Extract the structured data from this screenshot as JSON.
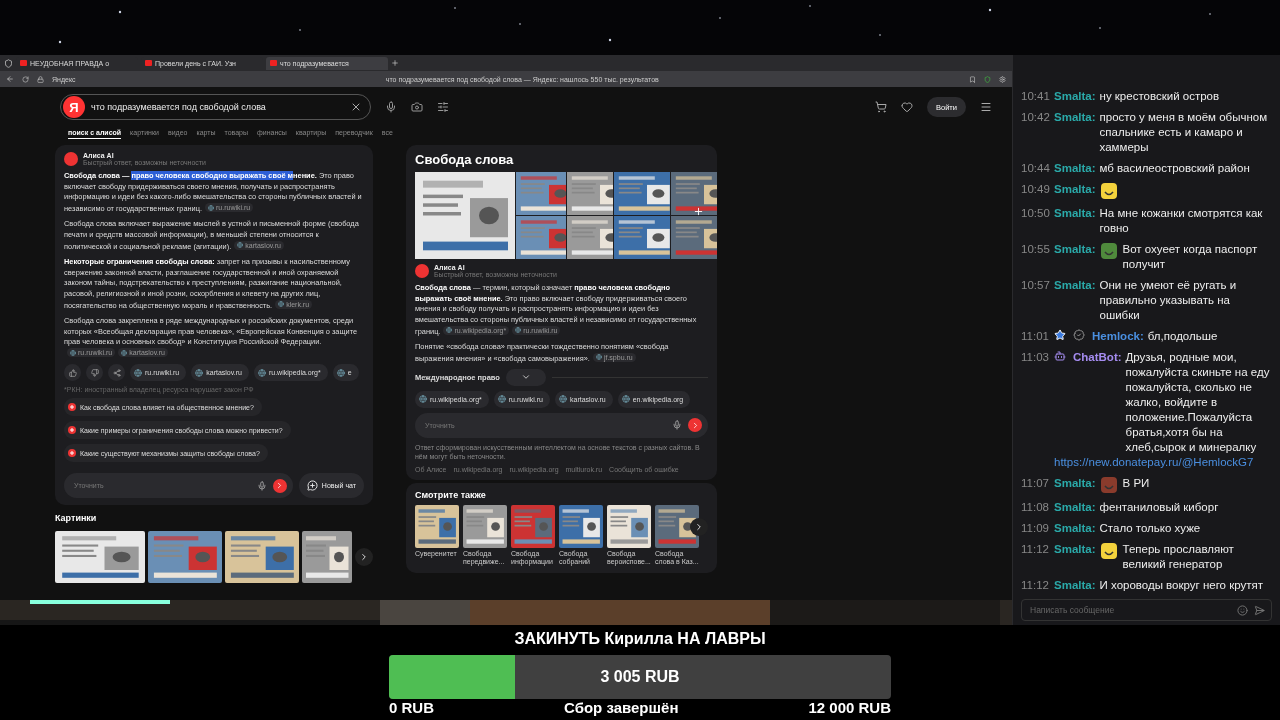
{
  "browser": {
    "tabs": [
      {
        "title": "НЕУДОБНАЯ ПРАВДА о",
        "selected": false
      },
      {
        "title": "Провели день с ГАИ. Узн",
        "selected": false
      },
      {
        "title": "что подразумевается",
        "selected": true
      }
    ],
    "address": {
      "site": "Яндекс",
      "title": "что подразумевается под свободой слова — Яндекс: нашлось 550 тыс. результатов"
    },
    "header": {
      "logo": "Я",
      "query": "что подразумевается под свободой слова",
      "login": "Войти",
      "nav": [
        {
          "label": "поиск с алисой",
          "selected": true
        },
        {
          "label": "картинки",
          "selected": false
        },
        {
          "label": "видео",
          "selected": false
        },
        {
          "label": "карты",
          "selected": false
        },
        {
          "label": "товары",
          "selected": false
        },
        {
          "label": "финансы",
          "selected": false
        },
        {
          "label": "квартиры",
          "selected": false
        },
        {
          "label": "переводчик",
          "selected": false
        },
        {
          "label": "все",
          "selected": false
        }
      ]
    },
    "ai_answer": {
      "name": "Алиса AI",
      "note": "Быстрый ответ, возможны неточности",
      "paragraphs": [
        {
          "text": "**Свобода слова —** ",
          "selection": "**право человека свободно выражать своё м**",
          "rest": "**нение.** Это право включает свободу придерживаться своего мнения, получать и распространять информацию и идеи без какого-либо вмешательства со стороны публичных властей и независимо от государственных границ.",
          "sources": [
            "ru.ruwiki.ru"
          ]
        },
        {
          "text": "Свобода слова включает выражение мыслей в устной и письменной форме (свобода печати и средств массовой информации), в меньшей степени относится к политической и социальной рекламе (агитации).",
          "sources": [
            "kartaslov.ru"
          ]
        },
        {
          "text": "**Некоторые ограничения свободы слова:** запрет на призывы к насильственному свержению законной власти, разглашение государственной и иной охраняемой законом тайны, подстрекательство к преступлениям, разжигание национальной, расовой, религиозной и иной розни, оскорбления и клевету на других лиц, посягательство на общественную мораль и нравственность.",
          "sources": [
            "klerk.ru"
          ]
        },
        {
          "text": "Свобода слова закреплена в ряде международных и российских документов, среди которых «Всеобщая декларация прав человека», «Европейская Конвенция о защите прав человека и основных свобод» и Конституция Российской Федерации.",
          "sources": [
            "ru.ruwiki.ru",
            "kartaslov.ru"
          ]
        }
      ],
      "source_chips": [
        "ru.ruwiki.ru",
        "kartaslov.ru",
        "ru.wikipedia.org*",
        "e"
      ],
      "footnote": "*РКН: иностранный владелец ресурса нарушает закон РФ",
      "suggestions": [
        "Как свобода слова влияет на общественное мнение?",
        "Какие примеры ограничения свободы слова можно привести?",
        "Какие существуют механизмы защиты свободы слова?"
      ],
      "refine_placeholder": "Уточнить",
      "new_chat": "Новый чат"
    },
    "images": {
      "title": "Картинки"
    },
    "knowledge_panel": {
      "title": "Свобода слова",
      "name": "Алиса AI",
      "note": "Быстрый ответ, возможны неточности",
      "paragraphs": [
        {
          "text": "**Свобода слова** — термин, который означает **право человека свободно выражать своё мнение.** Это право включает свободу придерживаться своего мнения и свободу получать и распространять информацию и идеи без вмешательства со стороны публичных властей и независимо от государственных границ.",
          "sources": [
            "ru.wikipedia.org*",
            "ru.ruwiki.ru"
          ]
        },
        {
          "text": "Понятие «свобода слова» практически тождественно понятиям «свобода выражения мнения» и «свобода самовыражения».",
          "sources": [
            "jf.spbu.ru"
          ]
        }
      ],
      "section": "Международное право",
      "source_chips": [
        "ru.wikipedia.org*",
        "ru.ruwiki.ru",
        "kartaslov.ru",
        "en.wikipedia.org"
      ],
      "refine_placeholder": "Уточнить",
      "disclaimer": "Ответ сформирован искусственным интеллектом на основе текстов с разных сайтов. В нём могут быть неточности.",
      "links": [
        "Об Алисе",
        "ru.wikipedia.org",
        "ru.wikipedia.org",
        "multiurok.ru",
        "Сообщить об ошибке"
      ]
    },
    "see_also": {
      "title": "Смотрите также",
      "items": [
        "Суверенитет",
        "Свобода передвиже...",
        "Свобода информации",
        "Свобода собраний",
        "Свобода вероиспове...",
        "Свобода слова в Каз..."
      ]
    }
  },
  "chat": {
    "messages": [
      {
        "time": "10:41",
        "user": "Smalta:",
        "color": "#2aa9a9",
        "text": "ну крестовский остров",
        "kind": "text"
      },
      {
        "time": "10:42",
        "user": "Smalta:",
        "color": "#2aa9a9",
        "text": "просто у меня в моём обычном спальнике есть и камаро и хаммеры",
        "kind": "text"
      },
      {
        "time": "10:44",
        "user": "Smalta:",
        "color": "#2aa9a9",
        "text": "мб василеостровский район",
        "kind": "text"
      },
      {
        "time": "10:49",
        "user": "Smalta:",
        "color": "#2aa9a9",
        "emote": {
          "color": "#f3d23c"
        },
        "kind": "text"
      },
      {
        "time": "10:50",
        "user": "Smalta:",
        "color": "#2aa9a9",
        "text": "На мне кожанки смотрятся как говно",
        "kind": "text"
      },
      {
        "time": "10:55",
        "user": "Smalta:",
        "color": "#2aa9a9",
        "emote": {
          "color": "#4f8a3c"
        },
        "text": "Вот охуеет когда паспорт получит",
        "kind": "text"
      },
      {
        "time": "10:57",
        "user": "Smalta:",
        "color": "#2aa9a9",
        "text": "Они не умеют её ругать и правильно указывать на ошибки",
        "kind": "text"
      },
      {
        "time": "11:01",
        "user": "Hemlock:",
        "color": "#4a8fe0",
        "badges": [
          {
            "kind": "star"
          },
          {
            "kind": "verified"
          }
        ],
        "text": "бл,подольше",
        "kind": "text"
      },
      {
        "time": "11:03",
        "user": "ChatBot:",
        "color": "#a58cf0",
        "badges": [
          {
            "kind": "bot"
          }
        ],
        "text": "Друзья, родные мои, пожалуйста скиньте на еду пожалуйста, сколько не жалко, войдите в положение.Пожалуйста братья,хотя бы на хлеб,сырок и минералку",
        "link": "https://new.donatepay.ru/@HemlockG7",
        "kind": "link"
      },
      {
        "time": "11:07",
        "user": "Smalta:",
        "color": "#2aa9a9",
        "emote": {
          "color": "#8a3b2c"
        },
        "text": "В РИ",
        "kind": "text"
      },
      {
        "time": "11:08",
        "user": "Smalta:",
        "color": "#2aa9a9",
        "text": "фентаниловый киборг",
        "kind": "text"
      },
      {
        "time": "11:09",
        "user": "Smalta:",
        "color": "#2aa9a9",
        "text": "Стало только хуже",
        "kind": "text"
      },
      {
        "time": "11:12",
        "user": "Smalta:",
        "color": "#2aa9a9",
        "emote": {
          "color": "#f3d23c"
        },
        "text": "Теперь прославляют великий генератор",
        "kind": "text"
      },
      {
        "time": "11:12",
        "user": "Smalta:",
        "color": "#2aa9a9",
        "text": "И хороводы вокруг него крутят",
        "kind": "text"
      }
    ],
    "input_placeholder": "Написать сообщение"
  },
  "donation": {
    "title": "ЗАКИНУТЬ Кирилла НА ЛАВРЫ",
    "amount": "3 005 RUB",
    "level": 0.25,
    "min": "0 RUB",
    "status": "Сбор завершён",
    "max": "12 000 RUB"
  }
}
